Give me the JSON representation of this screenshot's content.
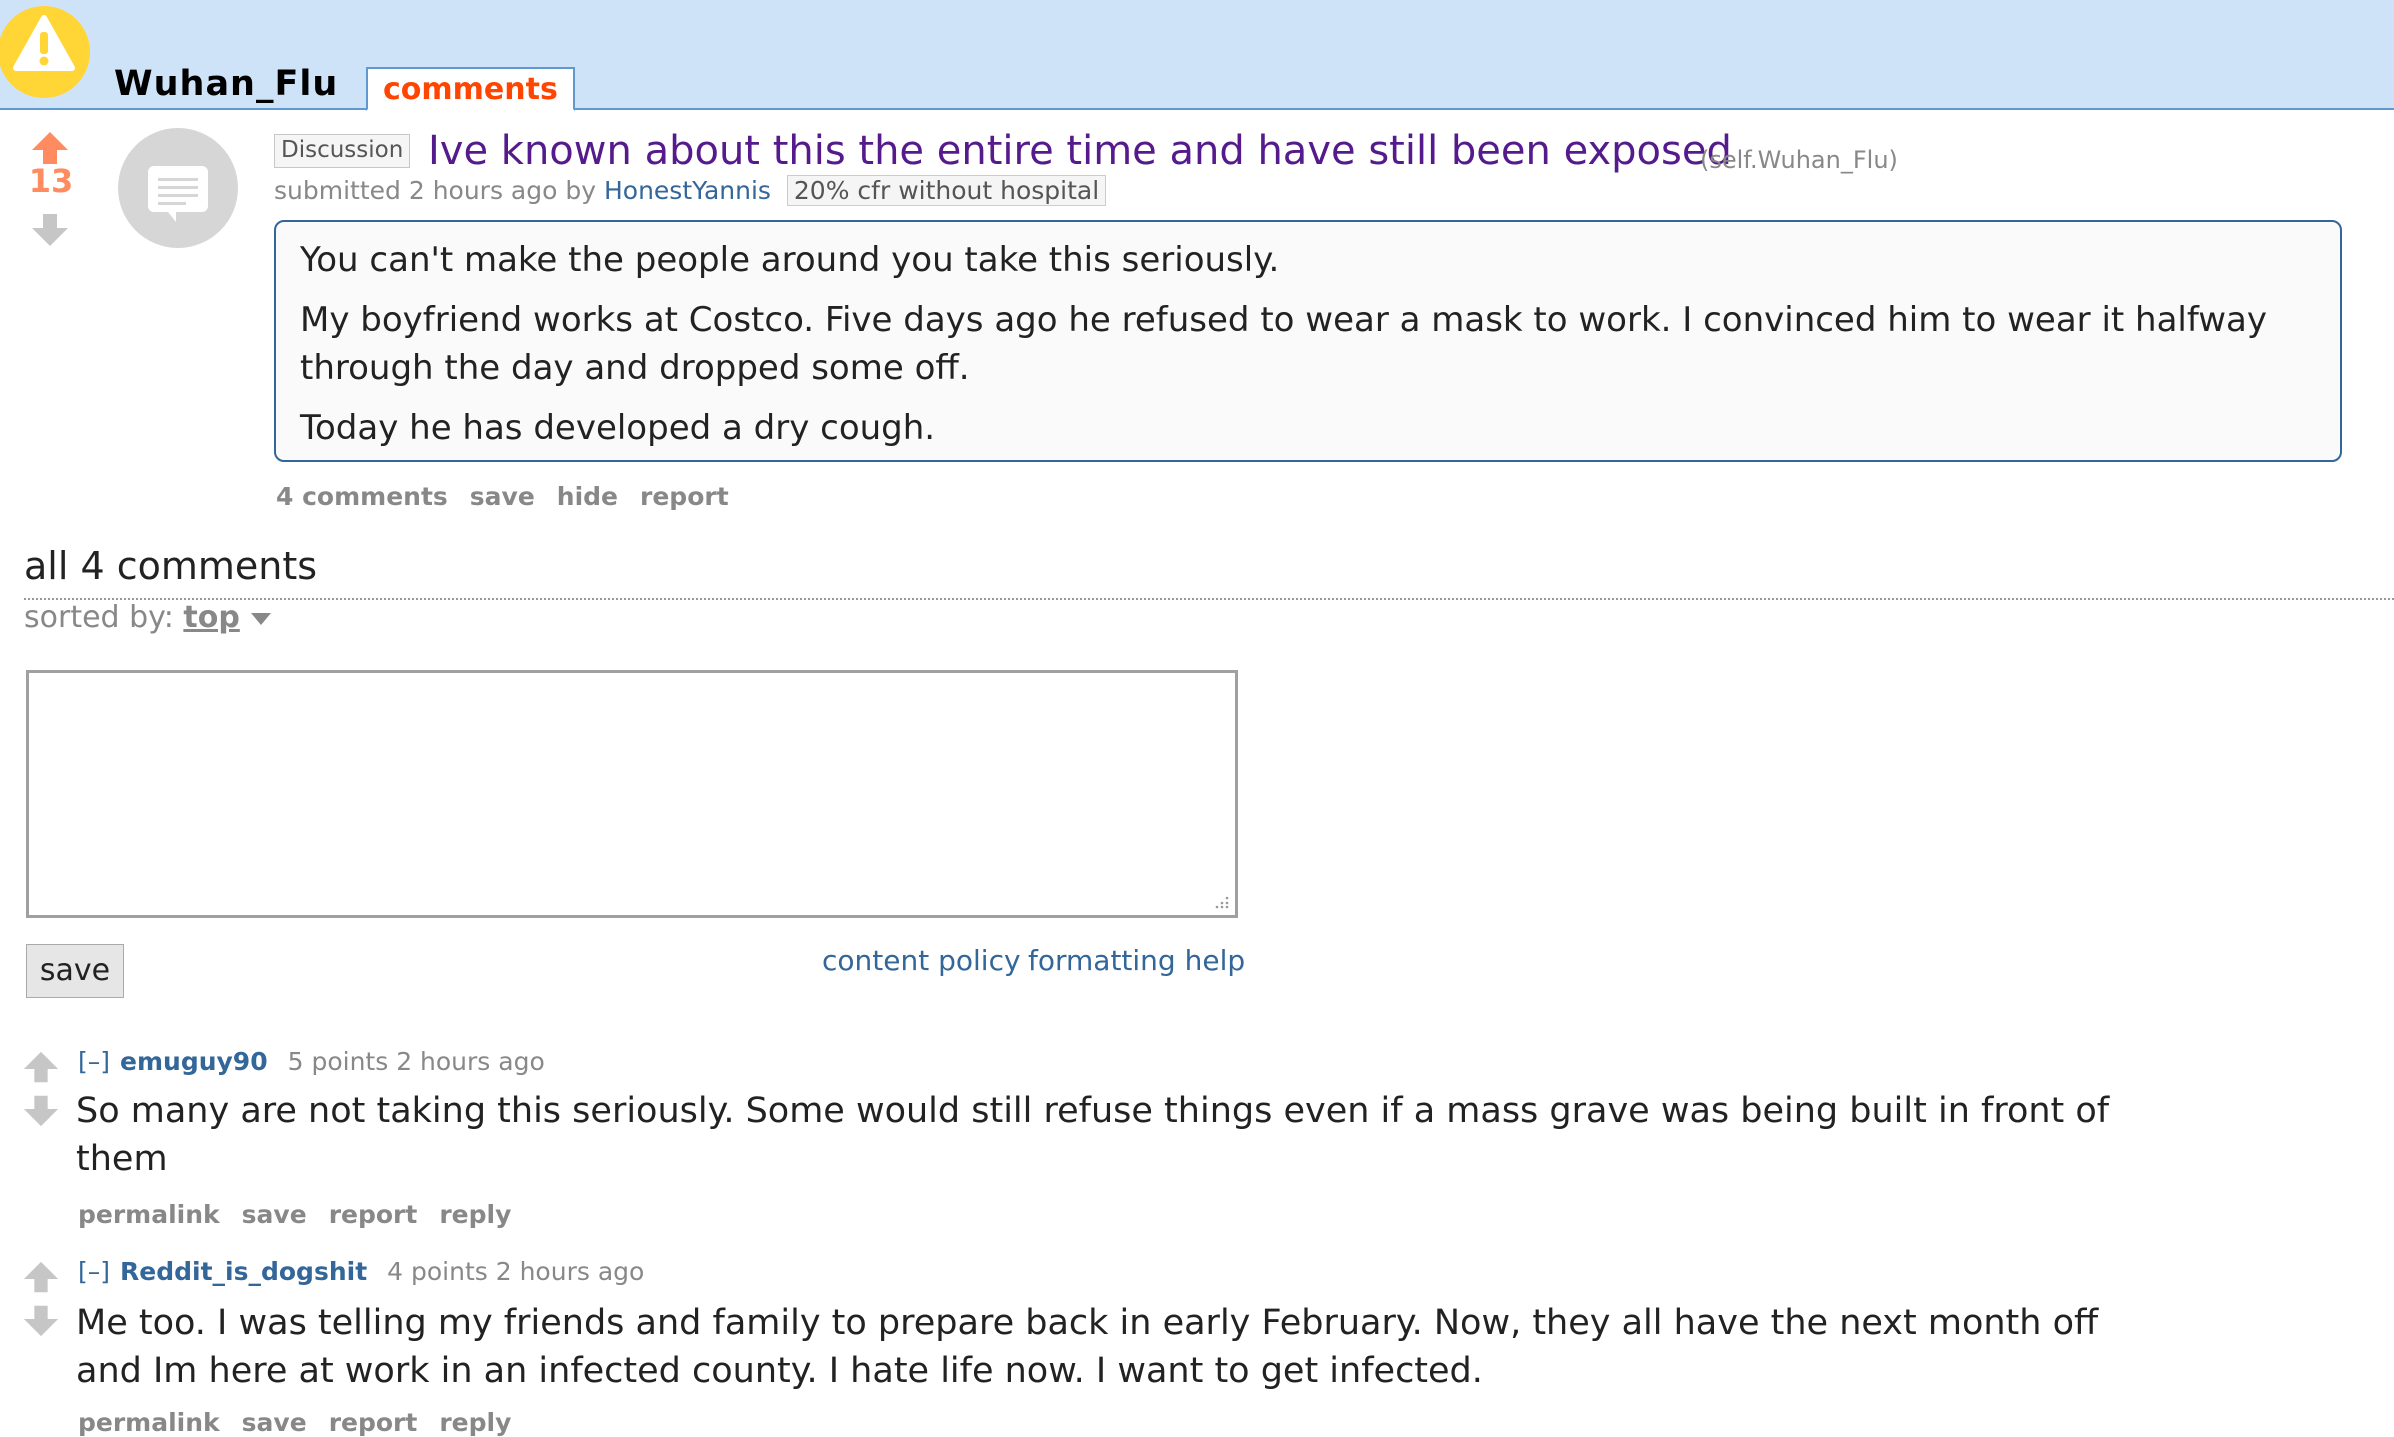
{
  "header": {
    "subreddit": "Wuhan_Flu",
    "active_tab": "comments",
    "colors": {
      "header_bg": "#cee3f8",
      "tab_text": "#ff4500",
      "logo": "#ffd635"
    }
  },
  "post": {
    "score": "13",
    "flair": "Discussion",
    "title": "Ive known about this the entire time and have still been exposed",
    "domain": "(self.Wuhan_Flu)",
    "tagline_prefix": "submitted 2 hours ago by",
    "author": "HonestYannis",
    "user_flair": "20% cfr without hospital",
    "body": [
      "You can't make the people around you take this seriously.",
      "My boyfriend works at Costco. Five days ago he refused to wear a mask to work. I convinced him to wear it halfway through the day and dropped some off.",
      "Today he has developed a dry cough."
    ],
    "buttons": [
      "4 comments",
      "save",
      "hide",
      "report"
    ],
    "thumbnail_icon": "self-post-icon"
  },
  "comment_area": {
    "count_label": "all 4 comments",
    "sort_label": "sorted by:",
    "sort_value": "top",
    "save_label": "save",
    "content_policy": "content policy",
    "formatting_help": "formatting help"
  },
  "comments": [
    {
      "collapse": "[–]",
      "author": "emuguy90",
      "meta": "5 points 2 hours ago",
      "body": "So many are not taking this seriously. Some would still refuse things even if a mass grave was being built in front of them",
      "buttons": [
        "permalink",
        "save",
        "report",
        "reply"
      ]
    },
    {
      "collapse": "[–]",
      "author": "Reddit_is_dogshit",
      "meta": "4 points 2 hours ago",
      "body": "Me too. I was telling my friends and family to prepare back in early February. Now, they all have the next month off and Im here at work in an infected county. I hate life now. I want to get infected.",
      "buttons": [
        "permalink",
        "save",
        "report",
        "reply"
      ]
    }
  ]
}
